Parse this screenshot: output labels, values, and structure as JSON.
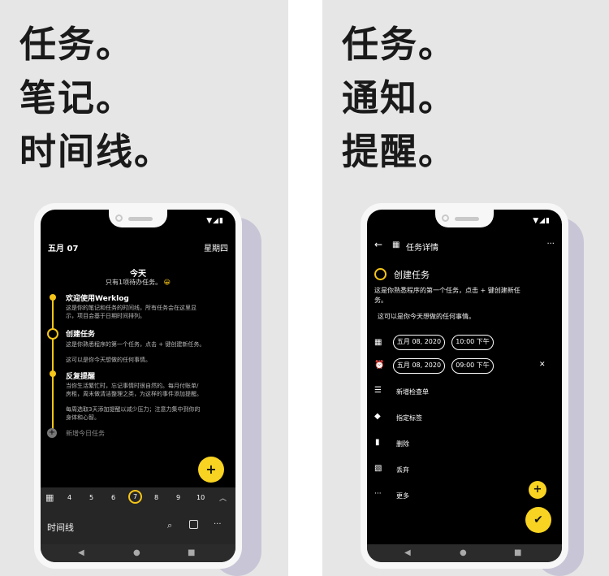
{
  "left": {
    "headline": [
      "任务。",
      "笔记。",
      "时间线。"
    ],
    "header": {
      "date": "五月 07",
      "weekday": "星期四"
    },
    "today": {
      "title": "今天",
      "subtitle": "只有1项待办任务。",
      "emoji": "😀"
    },
    "items": [
      {
        "title": "欢迎使用Werklog",
        "lines": [
          "这是你的笔记和任务的时间线，所有任务会在这里显",
          "示，项目会基于日期时间排列。"
        ]
      },
      {
        "title": "创建任务",
        "lines": [
          "这是你熟悉程序的第一个任务，点击 + 键创建新任务。",
          "",
          "这可以是你今天想做的任何事情。"
        ]
      },
      {
        "title": "反复提醒",
        "lines": [
          "当你生活繁忙时，忘记事情时很自然的。每月付账单/",
          "房租，周末做清洁整理之类，为这样的事件添加提醒。",
          "",
          "每周选取3天添加提醒以减少压力；注意力集中到你的",
          "身体和心智。"
        ]
      }
    ],
    "add_today": "新增今日任务",
    "fab": "+",
    "days": [
      "4",
      "5",
      "6",
      "7",
      "8",
      "9",
      "10"
    ],
    "selected_day": "7",
    "bottom_title": "时间线",
    "more": "···",
    "nav": [
      "◀",
      "●",
      "■"
    ],
    "status": "▼◢▮"
  },
  "right": {
    "headline": [
      "任务。",
      "通知。",
      "提醒。"
    ],
    "topbar": {
      "back": "←",
      "title": "任务详情",
      "more": "···"
    },
    "task_title": "创建任务",
    "desc": [
      "这是你熟悉程序的第一个任务，点击 + 键创建新任",
      "务。",
      "",
      "这可以是你今天想做的任何事情。"
    ],
    "due": {
      "date": "五月 08, 2020",
      "time": "10:00 下午"
    },
    "reminder": {
      "date": "五月 08, 2020",
      "time": "09:00 下午",
      "clear": "✕"
    },
    "menu": [
      "新增检查单",
      "指定标签",
      "删除",
      "丢弃",
      "更多"
    ],
    "fab_small": "+",
    "fab_check": "✔",
    "nav": [
      "◀",
      "●",
      "■"
    ],
    "status": "▼◢▮"
  },
  "colors": {
    "accent": "#f5c518",
    "panel_bg": "#e6e6e6",
    "screen_bg": "#000000"
  }
}
